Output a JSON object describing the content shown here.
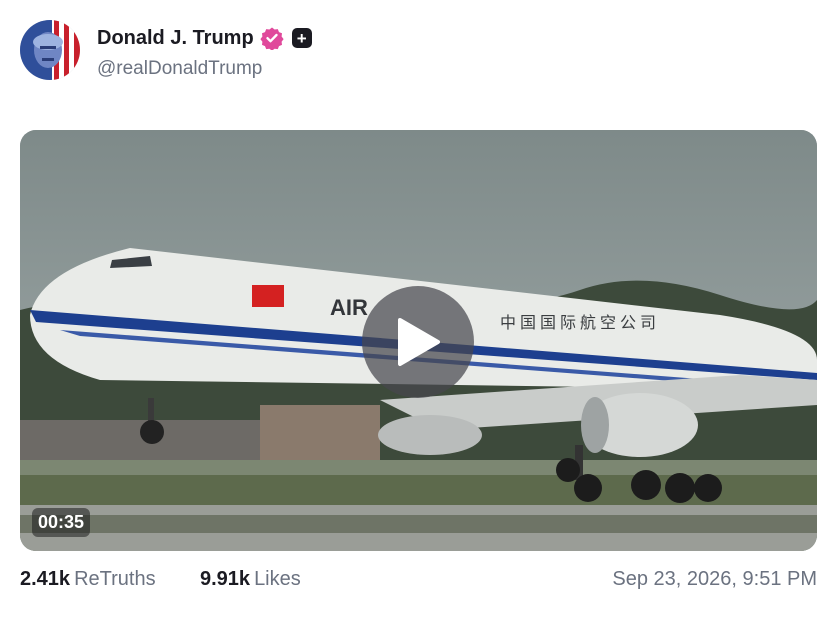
{
  "post": {
    "author": {
      "display_name": "Donald J. Trump",
      "handle": "@realDonaldTrump",
      "verified_icon": "verified-badge-icon",
      "plus_icon": "plus-square-icon"
    },
    "media": {
      "type": "video",
      "duration": "00:35",
      "play_icon": "play-icon"
    },
    "stats": {
      "retruths_count": "2.41k",
      "retruths_label": "ReTruths",
      "likes_count": "9.91k",
      "likes_label": "Likes"
    },
    "timestamp": "Sep 23, 2026, 9:51 PM"
  },
  "colors": {
    "verified": "#e0499b",
    "text_primary": "#1b1b22",
    "text_secondary": "#6b7280"
  }
}
